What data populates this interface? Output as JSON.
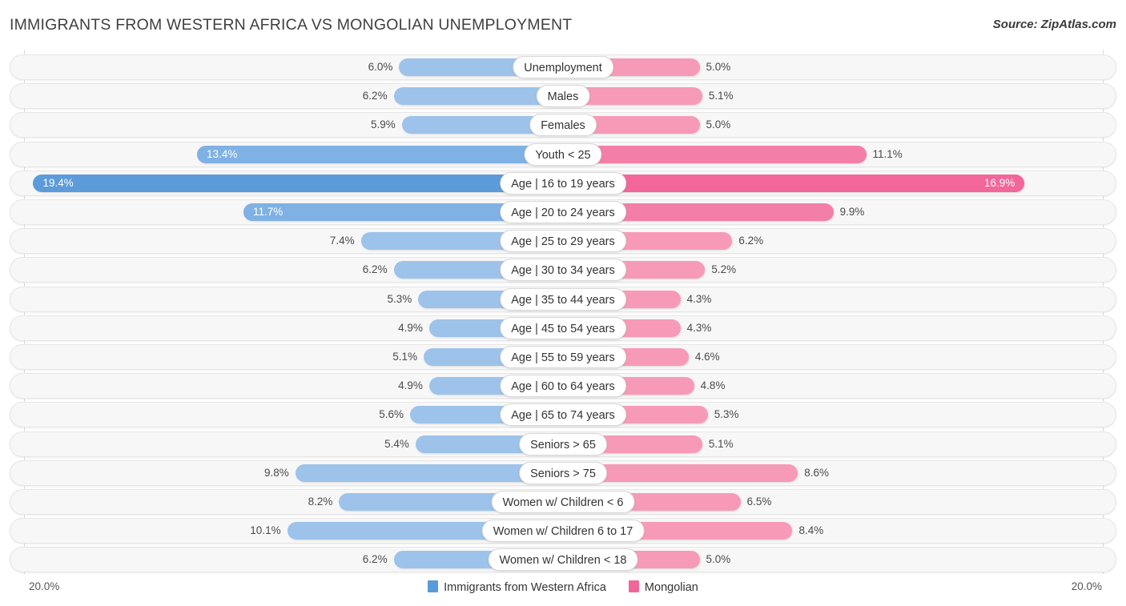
{
  "header": {
    "title": "IMMIGRANTS FROM WESTERN AFRICA VS MONGOLIAN UNEMPLOYMENT",
    "source": "Source: ZipAtlas.com"
  },
  "legend": {
    "items": [
      {
        "label": "Immigrants from Western Africa",
        "color": "#5b9bd9"
      },
      {
        "label": "Mongolian",
        "color": "#f2669a"
      }
    ]
  },
  "axis": {
    "left_end": "20.0%",
    "right_end": "20.0%",
    "max": 20.0
  },
  "colors": {
    "blue_light": "#9dc3ea",
    "blue_mid": "#7fb1e4",
    "blue_strong": "#5b9bd9",
    "pink_light": "#f79ab8",
    "pink_mid": "#f37fa8",
    "pink_strong": "#f2669a",
    "track_bg": "#f7f7f7",
    "track_border": "#e6e6e6",
    "gridline": "#dcdcdc"
  },
  "chart_data": {
    "type": "bar",
    "title": "IMMIGRANTS FROM WESTERN AFRICA VS MONGOLIAN UNEMPLOYMENT",
    "subtitle": "",
    "xlabel": "",
    "ylabel": "",
    "orientation": "horizontal-diverging",
    "xlim": [
      -20.0,
      20.0
    ],
    "grid": true,
    "legend_position": "bottom-center",
    "categories": [
      "Unemployment",
      "Males",
      "Females",
      "Youth < 25",
      "Age | 16 to 19 years",
      "Age | 20 to 24 years",
      "Age | 25 to 29 years",
      "Age | 30 to 34 years",
      "Age | 35 to 44 years",
      "Age | 45 to 54 years",
      "Age | 55 to 59 years",
      "Age | 60 to 64 years",
      "Age | 65 to 74 years",
      "Seniors > 65",
      "Seniors > 75",
      "Women w/ Children < 6",
      "Women w/ Children 6 to 17",
      "Women w/ Children < 18"
    ],
    "series": [
      {
        "name": "Immigrants from Western Africa",
        "color": "#5b9bd9",
        "side": "left",
        "values": [
          6.0,
          6.2,
          5.9,
          13.4,
          19.4,
          11.7,
          7.4,
          6.2,
          5.3,
          4.9,
          5.1,
          4.9,
          5.6,
          5.4,
          9.8,
          8.2,
          10.1,
          6.2
        ],
        "labels": [
          "6.0%",
          "6.2%",
          "5.9%",
          "13.4%",
          "19.4%",
          "11.7%",
          "7.4%",
          "6.2%",
          "5.3%",
          "4.9%",
          "5.1%",
          "4.9%",
          "5.6%",
          "5.4%",
          "9.8%",
          "8.2%",
          "10.1%",
          "6.2%"
        ]
      },
      {
        "name": "Mongolian",
        "color": "#f2669a",
        "side": "right",
        "values": [
          5.0,
          5.1,
          5.0,
          11.1,
          16.9,
          9.9,
          6.2,
          5.2,
          4.3,
          4.3,
          4.6,
          4.8,
          5.3,
          5.1,
          8.6,
          6.5,
          8.4,
          5.0
        ],
        "labels": [
          "5.0%",
          "5.1%",
          "5.0%",
          "11.1%",
          "16.9%",
          "9.9%",
          "6.2%",
          "5.2%",
          "4.3%",
          "4.3%",
          "4.6%",
          "4.8%",
          "5.3%",
          "5.1%",
          "8.6%",
          "6.5%",
          "8.4%",
          "5.0%"
        ]
      }
    ]
  },
  "rows": [
    {
      "label": "Unemployment",
      "left_value": 6.0,
      "left_label": "6.0%",
      "right_value": 5.0,
      "right_label": "5.0%",
      "intensity": "light"
    },
    {
      "label": "Males",
      "left_value": 6.2,
      "left_label": "6.2%",
      "right_value": 5.1,
      "right_label": "5.1%",
      "intensity": "light"
    },
    {
      "label": "Females",
      "left_value": 5.9,
      "left_label": "5.9%",
      "right_value": 5.0,
      "right_label": "5.0%",
      "intensity": "light"
    },
    {
      "label": "Youth < 25",
      "left_value": 13.4,
      "left_label": "13.4%",
      "right_value": 11.1,
      "right_label": "11.1%",
      "intensity": "mid"
    },
    {
      "label": "Age | 16 to 19 years",
      "left_value": 19.4,
      "left_label": "19.4%",
      "right_value": 16.9,
      "right_label": "16.9%",
      "intensity": "strong"
    },
    {
      "label": "Age | 20 to 24 years",
      "left_value": 11.7,
      "left_label": "11.7%",
      "right_value": 9.9,
      "right_label": "9.9%",
      "intensity": "mid"
    },
    {
      "label": "Age | 25 to 29 years",
      "left_value": 7.4,
      "left_label": "7.4%",
      "right_value": 6.2,
      "right_label": "6.2%",
      "intensity": "light"
    },
    {
      "label": "Age | 30 to 34 years",
      "left_value": 6.2,
      "left_label": "6.2%",
      "right_value": 5.2,
      "right_label": "5.2%",
      "intensity": "light"
    },
    {
      "label": "Age | 35 to 44 years",
      "left_value": 5.3,
      "left_label": "5.3%",
      "right_value": 4.3,
      "right_label": "4.3%",
      "intensity": "light"
    },
    {
      "label": "Age | 45 to 54 years",
      "left_value": 4.9,
      "left_label": "4.9%",
      "right_value": 4.3,
      "right_label": "4.3%",
      "intensity": "light"
    },
    {
      "label": "Age | 55 to 59 years",
      "left_value": 5.1,
      "left_label": "5.1%",
      "right_value": 4.6,
      "right_label": "4.6%",
      "intensity": "light"
    },
    {
      "label": "Age | 60 to 64 years",
      "left_value": 4.9,
      "left_label": "4.9%",
      "right_value": 4.8,
      "right_label": "4.8%",
      "intensity": "light"
    },
    {
      "label": "Age | 65 to 74 years",
      "left_value": 5.6,
      "left_label": "5.6%",
      "right_value": 5.3,
      "right_label": "5.3%",
      "intensity": "light"
    },
    {
      "label": "Seniors > 65",
      "left_value": 5.4,
      "left_label": "5.4%",
      "right_value": 5.1,
      "right_label": "5.1%",
      "intensity": "light"
    },
    {
      "label": "Seniors > 75",
      "left_value": 9.8,
      "left_label": "9.8%",
      "right_value": 8.6,
      "right_label": "8.6%",
      "intensity": "light"
    },
    {
      "label": "Women w/ Children < 6",
      "left_value": 8.2,
      "left_label": "8.2%",
      "right_value": 6.5,
      "right_label": "6.5%",
      "intensity": "light"
    },
    {
      "label": "Women w/ Children 6 to 17",
      "left_value": 10.1,
      "left_label": "10.1%",
      "right_value": 8.4,
      "right_label": "8.4%",
      "intensity": "light"
    },
    {
      "label": "Women w/ Children < 18",
      "left_value": 6.2,
      "left_label": "6.2%",
      "right_value": 5.0,
      "right_label": "5.0%",
      "intensity": "light"
    }
  ]
}
